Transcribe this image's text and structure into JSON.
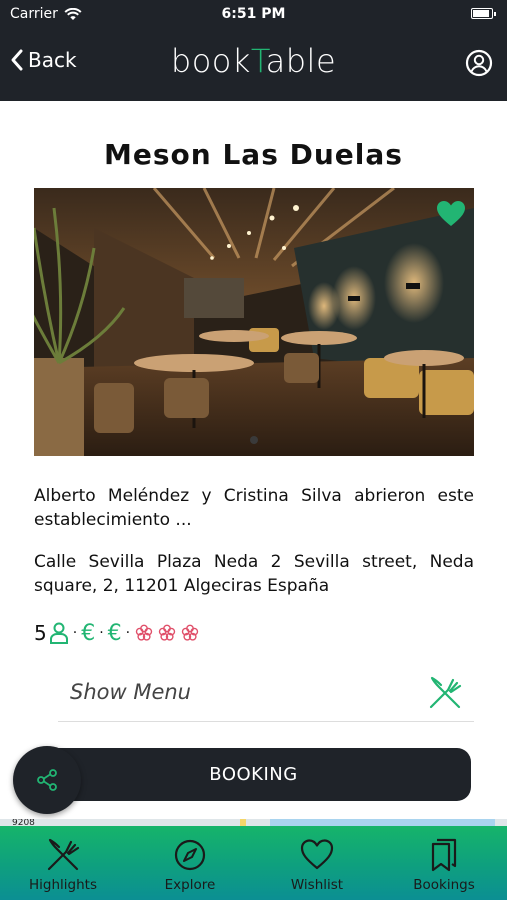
{
  "status_bar": {
    "carrier": "Carrier",
    "time": "6:51 PM"
  },
  "nav": {
    "back_label": "Back",
    "logo_prefix": "book",
    "logo_accent": "T",
    "logo_suffix": "able"
  },
  "restaurant": {
    "name": "Meson Las Duelas",
    "description": "Alberto Meléndez y Cristina Silva abrieron este establecimiento ...",
    "address": "Calle Sevilla Plaza Neda 2 Sevilla street, Neda square, 2, 11201 Algeciras España",
    "capacity": "5",
    "price_symbols": [
      "€",
      "€"
    ],
    "favorite": true
  },
  "menu_row": {
    "label": "Show Menu"
  },
  "booking_button": {
    "label": "BOOKING"
  },
  "map_strip": {
    "label": "9208"
  },
  "tabs": [
    {
      "label": "Highlights",
      "icon": "fork-knife-icon"
    },
    {
      "label": "Explore",
      "icon": "compass-icon"
    },
    {
      "label": "Wishlist",
      "icon": "heart-icon"
    },
    {
      "label": "Bookings",
      "icon": "bookmarks-icon"
    }
  ],
  "colors": {
    "accent": "#22b573",
    "dark": "#1f2329",
    "michelin": "#e0506a"
  }
}
